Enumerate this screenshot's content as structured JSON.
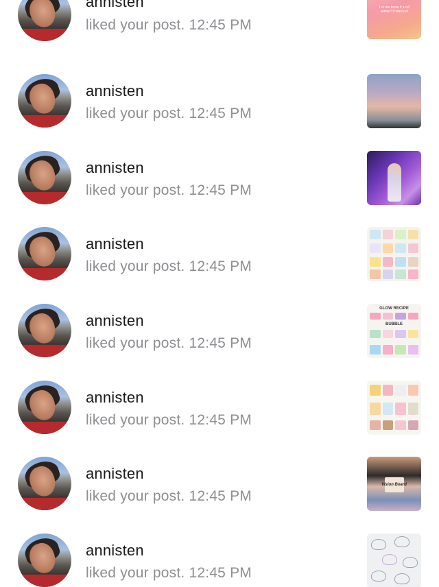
{
  "notifications": [
    {
      "username": "annisten",
      "activity": "liked your post.",
      "time": "12:45 PM",
      "thumbnail_caption": "Let me know if a ref winner! If checked",
      "thumbnail": "pink-gradient-quote"
    },
    {
      "username": "annisten",
      "activity": "liked your post.",
      "time": "12:45 PM",
      "thumbnail": "sunset-sky-trees"
    },
    {
      "username": "annisten",
      "activity": "liked your post.",
      "time": "12:45 PM",
      "thumbnail": "concert-performer-purple"
    },
    {
      "username": "annisten",
      "activity": "liked your post.",
      "time": "12:45 PM",
      "thumbnail": "skincare-products-collage"
    },
    {
      "username": "annisten",
      "activity": "liked your post.",
      "time": "12:45 PM",
      "thumbnail_caption": "GLOW RECIPE",
      "thumbnail_caption_2": "BUBBLE",
      "thumbnail": "glow-recipe-bubble-products"
    },
    {
      "username": "annisten",
      "activity": "liked your post.",
      "time": "12:45 PM",
      "thumbnail": "haircare-products-collage"
    },
    {
      "username": "annisten",
      "activity": "liked your post.",
      "time": "12:45 PM",
      "thumbnail_caption": "Vision Board",
      "thumbnail": "vision-board-collage"
    },
    {
      "username": "annisten",
      "activity": "liked your post.",
      "time": "12:45 PM",
      "thumbnail": "seashell-pattern"
    }
  ],
  "colors": {
    "username": "#1a1a1a",
    "secondary_text": "#8e8e93",
    "background": "#ffffff"
  }
}
